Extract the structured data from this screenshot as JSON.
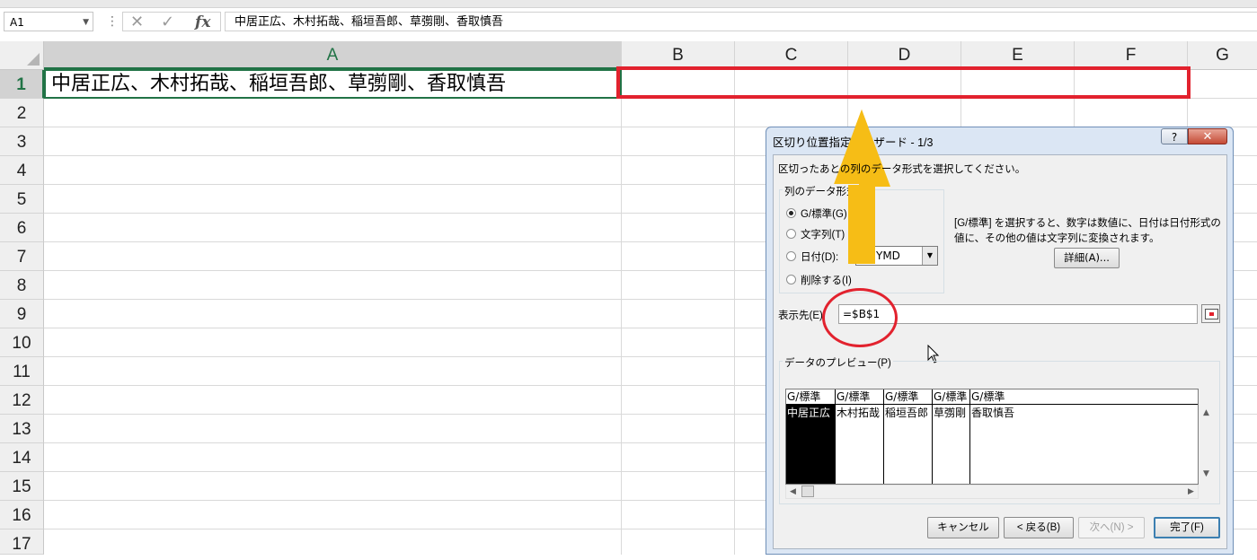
{
  "formula_bar": {
    "name_box": "A1",
    "separator": "⋮",
    "cancel_icon": "✕",
    "enter_icon": "✓",
    "fx_label": "fx",
    "formula": "中居正広、木村拓哉、稲垣吾郎、草彅剛、香取慎吾"
  },
  "grid": {
    "columns": [
      "A",
      "B",
      "C",
      "D",
      "E",
      "F",
      "G"
    ],
    "rows": [
      "1",
      "2",
      "3",
      "4",
      "5",
      "6",
      "7",
      "8",
      "9",
      "10",
      "11",
      "12",
      "13",
      "14",
      "15",
      "16",
      "17"
    ],
    "cell_a1": "中居正広、木村拓哉、稲垣吾郎、草彅剛、香取慎吾"
  },
  "dialog": {
    "title": "区切り位置指定ウィザード - 1/3",
    "help_label": "?",
    "close_label": "✕",
    "instruction": "区切ったあとの列のデータ形式を選択してください。",
    "group_label": "列のデータ形式",
    "radios": [
      {
        "label": "G/標準(G)",
        "checked": true
      },
      {
        "label": "文字列(T)",
        "checked": false
      },
      {
        "label": "日付(D):",
        "checked": false
      },
      {
        "label": "削除する(I)",
        "checked": false
      }
    ],
    "date_format": "YMD",
    "description_line1": "[G/標準] を選択すると、数字は数値に、日付は日付形式の",
    "description_line2": "値に、その他の値は文字列に変換されます。",
    "detail_button": "詳細(A)...",
    "dest_label": "表示先(E):",
    "dest_value": "=$B$1",
    "preview_label": "データのプレビュー(P)",
    "preview_headers": [
      "G/標準",
      "G/標準",
      "G/標準",
      "G/標準",
      "G/標準"
    ],
    "preview_values": [
      "中居正広",
      "木村拓哉",
      "稲垣吾郎",
      "草彅剛",
      "香取慎吾"
    ],
    "buttons": {
      "cancel": "キャンセル",
      "back": "< 戻る(B)",
      "next": "次へ(N) >",
      "finish": "完了(F)"
    }
  },
  "annotation_colors": {
    "highlight_red": "#e2222e",
    "arrow_yellow": "#f6bd16"
  }
}
